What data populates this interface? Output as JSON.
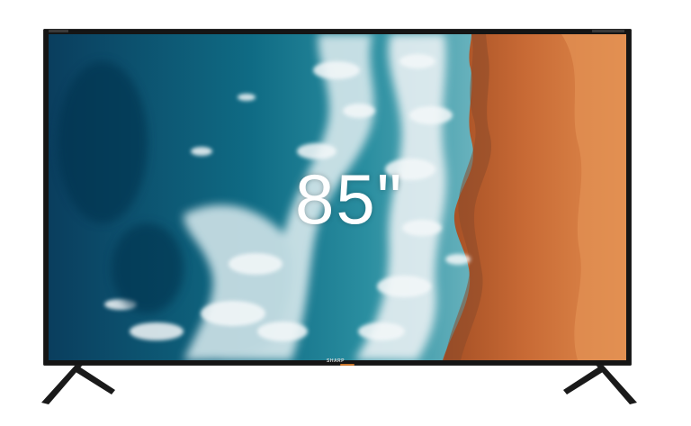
{
  "product": {
    "size_label": "85\"",
    "brand": "SHARP"
  },
  "colors": {
    "bezel": "#151515",
    "deep_sea": "#0b4a6d",
    "foam": "#e8f0f3",
    "sand": "#c86a35",
    "indicator": "#c8742a"
  },
  "icons": {
    "left_stand": "tv-stand-leg-icon",
    "right_stand": "tv-stand-leg-icon"
  }
}
